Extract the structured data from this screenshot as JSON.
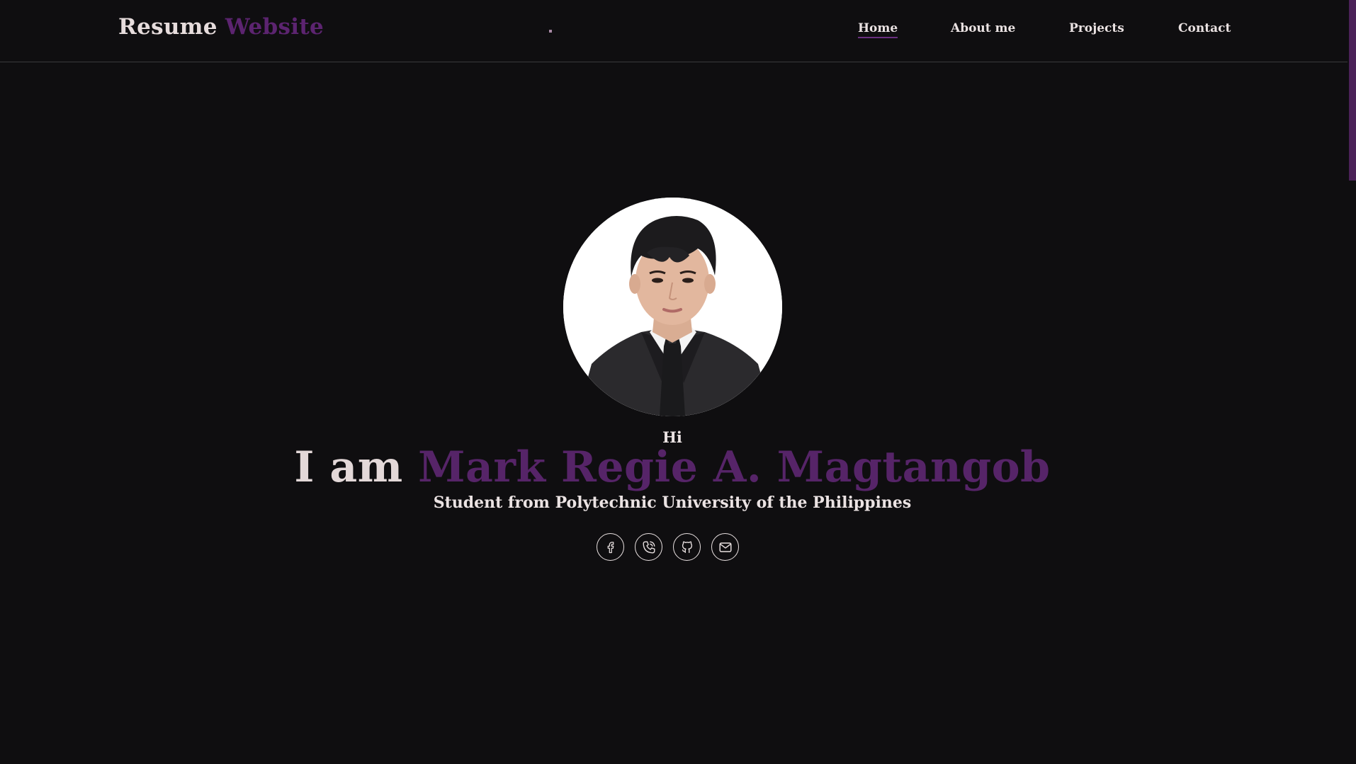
{
  "header": {
    "logo_first": "Resume",
    "logo_second": "Website",
    "nav": [
      {
        "label": "Home",
        "active": true
      },
      {
        "label": "About me",
        "active": false
      },
      {
        "label": "Projects",
        "active": false
      },
      {
        "label": "Contact",
        "active": false
      }
    ]
  },
  "hero": {
    "greeting": "Hi",
    "lead": "I am",
    "name": "Mark Regie A. Magtangob",
    "subtitle": "Student from Polytechnic University of the Philippines",
    "profile_photo": "profile-photo",
    "socials": [
      {
        "icon": "facebook-icon"
      },
      {
        "icon": "phone-icon"
      },
      {
        "icon": "github-icon"
      },
      {
        "icon": "email-icon"
      }
    ]
  },
  "colors": {
    "background": "#0f0e10",
    "accent_purple": "#562468",
    "text_light": "#ebe3e3",
    "scrollbar_thumb": "#4b2158"
  }
}
